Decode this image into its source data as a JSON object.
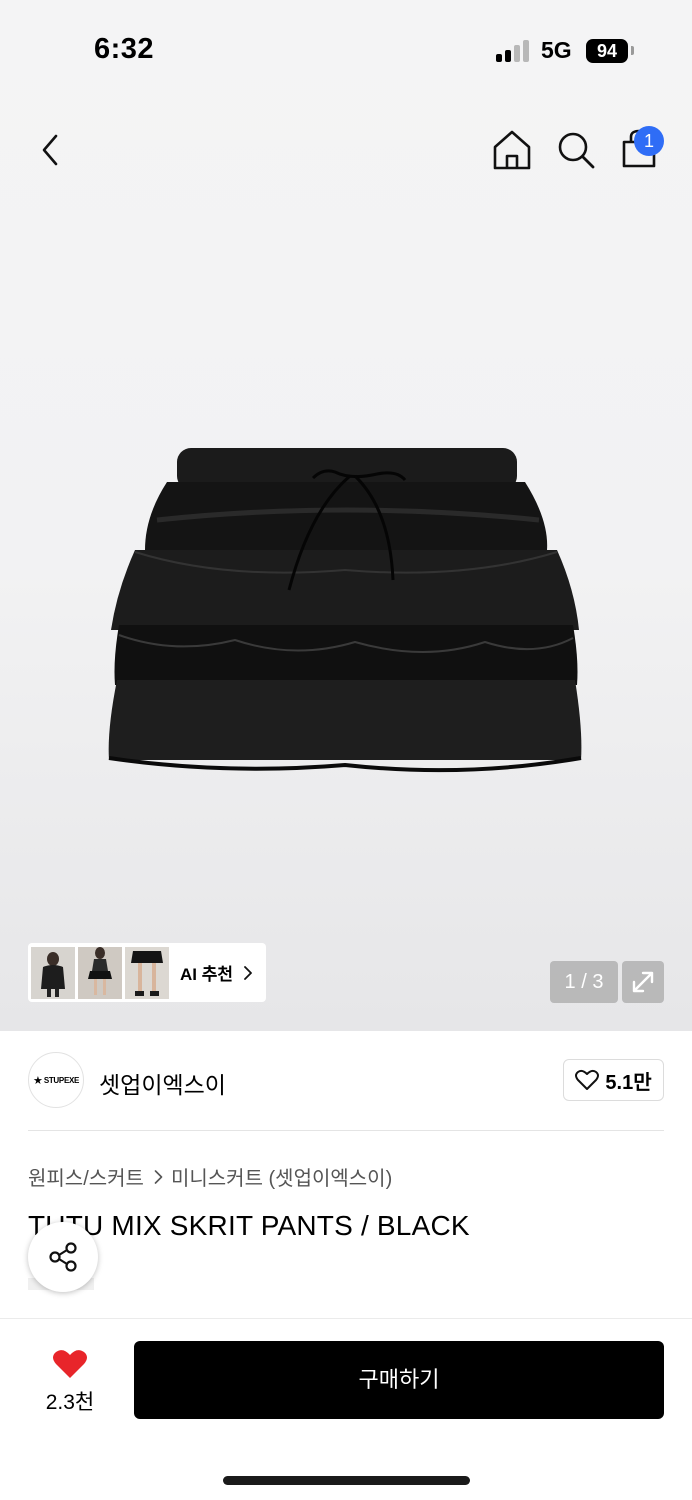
{
  "status_bar": {
    "time": "6:32",
    "network": "5G",
    "battery": "94"
  },
  "header": {
    "cart_count": "1"
  },
  "gallery": {
    "ai_label": "AI 추천",
    "page_indicator": "1 / 3"
  },
  "brand": {
    "logo_text": "STUPEXE",
    "name": "셋업이엑스이",
    "likes": "5.1만"
  },
  "breadcrumb": [
    "원피스/스커트",
    "미니스커트 (셋업이엑스이)"
  ],
  "product": {
    "title": "TUTU MIX SKRIT PANTS / BLACK"
  },
  "bottom_bar": {
    "wish_count": "2.3천",
    "buy_label": "구매하기"
  },
  "colors": {
    "accent_blue": "#2f6df6",
    "heart_red": "#e8252a",
    "buy_button": "#000000"
  },
  "icons": [
    "chevron-left-icon",
    "home-icon",
    "search-icon",
    "shopping-bag-icon",
    "chevron-right-icon",
    "expand-icon",
    "heart-outline-icon",
    "share-icon",
    "heart-filled-icon"
  ]
}
